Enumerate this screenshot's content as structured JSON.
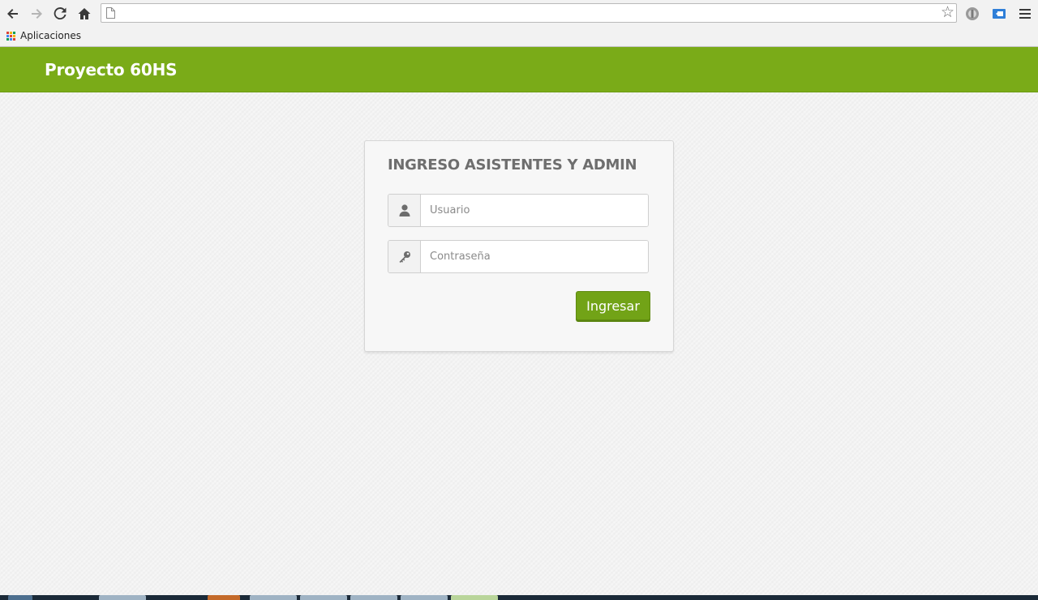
{
  "browser": {
    "url": "",
    "bookmarks": [
      {
        "label": "Aplicaciones",
        "icon": "apps-grid-icon"
      }
    ],
    "toolbar_icons": [
      "back-arrow-icon",
      "forward-arrow-icon",
      "reload-icon",
      "home-icon",
      "star-icon",
      "extension-icon",
      "extension-icon",
      "menu-icon"
    ]
  },
  "navbar": {
    "brand": "Proyecto 60HS",
    "color": "#7aab18"
  },
  "login": {
    "title": "INGRESO ASISTENTES Y ADMIN",
    "username": {
      "placeholder": "Usuario",
      "value": "",
      "icon": "user-icon"
    },
    "password": {
      "placeholder": "Contraseña",
      "value": "",
      "icon": "key-icon"
    },
    "submit_label": "Ingresar",
    "button_color": "#72a317"
  }
}
